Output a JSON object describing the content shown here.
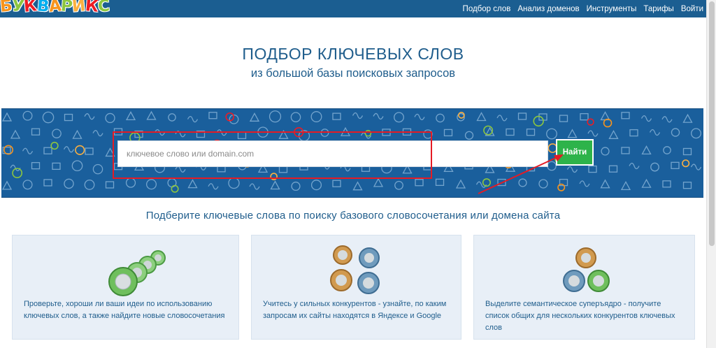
{
  "header": {
    "logo_letters": [
      "Б",
      "У",
      "К",
      "В",
      "А",
      "Р",
      "И",
      "К",
      "С"
    ],
    "logo_colors": [
      "#f7941d",
      "#8dc63f",
      "#ed1c24",
      "#00aeef",
      "#f7941d",
      "#8dc63f",
      "#fbb040",
      "#ed1c24",
      "#8dc63f"
    ],
    "nav": [
      {
        "label": "Подбор слов"
      },
      {
        "label": "Анализ доменов"
      },
      {
        "label": "Инструменты"
      },
      {
        "label": "Тарифы"
      },
      {
        "label": "Войти"
      }
    ]
  },
  "hero": {
    "title": "ПОДБОР КЛЮЧЕВЫХ СЛОВ",
    "subtitle": "из большой базы поисковых запросов"
  },
  "search": {
    "placeholder": "ключевое слово или domain.com",
    "value": "",
    "button_label": "Найти"
  },
  "section": {
    "heading": "Подберите ключевые слова по поиску базового словосочетания или домена сайта"
  },
  "cards": [
    {
      "text": "Проверьте, хороши ли ваши идеи по использованию ключевых слов, а также найдите новые словосочетания",
      "icon": "green-keyrings-icon"
    },
    {
      "text": "Учитесь у сильных конкурентов - узнайте, по каким запросам их сайты находятся в Яндексе и Google",
      "icon": "competitor-keys-icon"
    },
    {
      "text": "Выделите семантическое суперъядро - получите список общих для нескольких конкурентов ключевых слов",
      "icon": "semantic-core-keys-icon"
    }
  ],
  "colors": {
    "topbar": "#1b5e91",
    "band": "#1a5f9c",
    "accent_text": "#1f5d8c",
    "find_button": "#2db34a",
    "annotation_red": "#e51b24",
    "card_bg": "#e8eff7"
  }
}
